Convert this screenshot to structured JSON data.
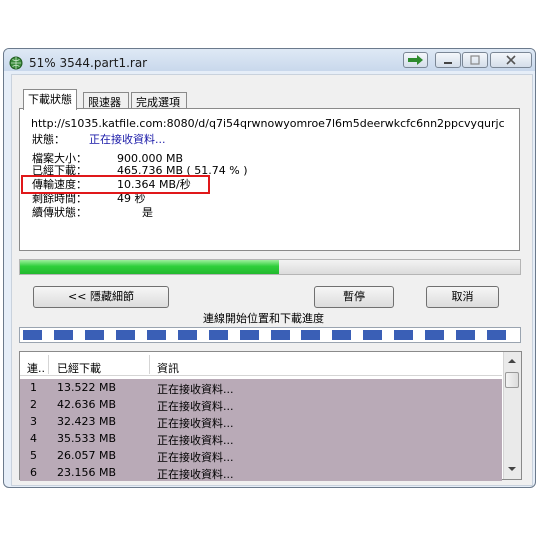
{
  "window": {
    "title": "51% 3544.part1.rar",
    "icon": "app-globe-icon"
  },
  "tabs": [
    {
      "label": "下載狀態",
      "active": true
    },
    {
      "label": "限速器",
      "active": false
    },
    {
      "label": "完成選項",
      "active": false
    }
  ],
  "status": {
    "url": "http://s1035.katfile.com:8080/d/q7i54qrwnowyomroe7l6m5deerwkcfc6nn2ppcvyqurjc",
    "fields": [
      {
        "label": "狀態：",
        "value": "正在接收資料..."
      },
      {
        "label": "檔案大小：",
        "value": "900.000  MB"
      },
      {
        "label": "已經下載：",
        "value": "465.736  MB  ( 51.74 % )"
      },
      {
        "label": "傳輸速度：",
        "value": "10.364  MB/秒"
      },
      {
        "label": "剩餘時間：",
        "value": "49 秒"
      },
      {
        "label": "續傳狀態：",
        "value": "是"
      }
    ]
  },
  "progress": {
    "fraction": 0.5174
  },
  "buttons": {
    "hide_details": "<< 隱藏細節",
    "pause": "暫停",
    "cancel": "取消"
  },
  "segments_caption": "連線開始位置和下載進度",
  "table": {
    "headers": [
      "連..",
      "已經下載",
      "資訊"
    ],
    "rows": [
      [
        "1",
        "13.522  MB",
        "正在接收資料..."
      ],
      [
        "2",
        "42.636  MB",
        "正在接收資料..."
      ],
      [
        "3",
        "32.423  MB",
        "正在接收資料..."
      ],
      [
        "4",
        "35.533  MB",
        "正在接收資料..."
      ],
      [
        "5",
        "26.057  MB",
        "正在接收資料..."
      ],
      [
        "6",
        "23.156  MB",
        "正在接收資料..."
      ]
    ]
  },
  "colors": {
    "highlight_box": "#e0181a",
    "progress_green": "#2fcf3b",
    "segment_blue": "#3a5fb6",
    "row_bg": "#b9aab7",
    "status_text": "#1a1aa8"
  }
}
